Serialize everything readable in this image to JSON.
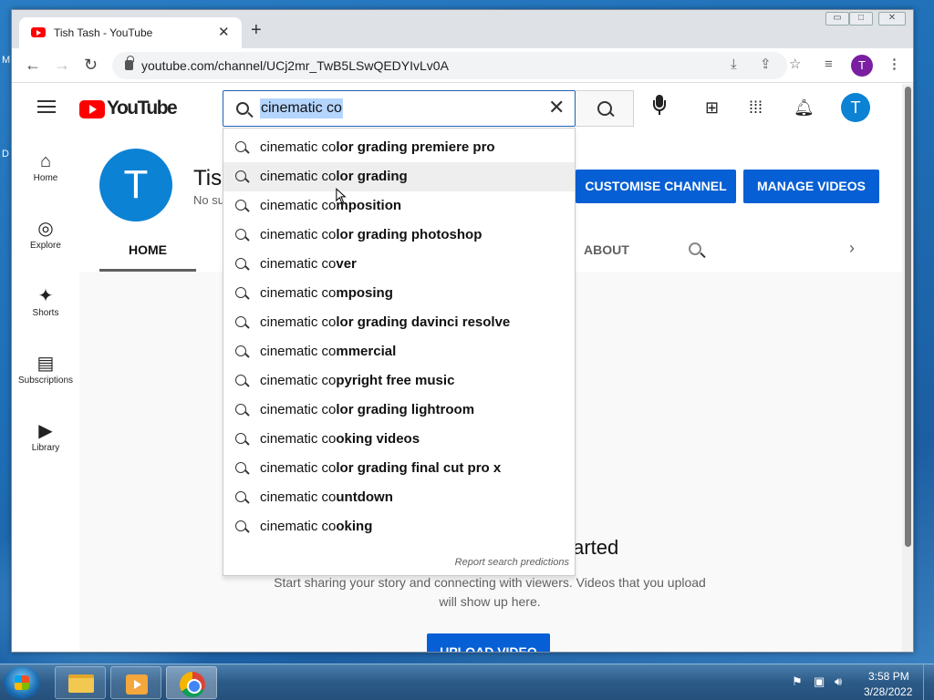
{
  "desktop": {
    "left_letter_1": "M",
    "left_letter_2": "D"
  },
  "browser": {
    "tab_title": "Tish Tash - YouTube",
    "tab_close": "✕",
    "new_tab": "+",
    "address": "youtube.com/channel/UCj2mr_TwB5LSwQEDYIvLv0A",
    "profile_initial": "T",
    "window_controls": [
      "▭",
      "□",
      "✕"
    ]
  },
  "youtube": {
    "logo_text": "YouTube",
    "search": {
      "query": "cinematic co",
      "clear": "✕"
    },
    "avatar_initial": "T",
    "sidebar": [
      {
        "label": "Home",
        "glyph": "⌂"
      },
      {
        "label": "Explore",
        "glyph": "◎"
      },
      {
        "label": "Shorts",
        "glyph": "✦"
      },
      {
        "label": "Subscriptions",
        "glyph": "▤"
      },
      {
        "label": "Library",
        "glyph": "▶"
      }
    ],
    "channel": {
      "avatar_initial": "T",
      "name": "Tis",
      "subs": "No su",
      "customise_button": "CUSTOMISE CHANNEL",
      "manage_button": "MANAGE VIDEOS",
      "tab_home": "HOME",
      "tab_about": "ABOUT",
      "tab_next": "›"
    },
    "empty_state": {
      "title": "tarted",
      "text": "Start sharing your story and connecting with viewers. Videos that you upload will show up here.",
      "upload_button": "UPLOAD VIDEO"
    },
    "suggestions": [
      {
        "prefix": "cinematic co",
        "rest": "lor grading premiere pro"
      },
      {
        "prefix": "cinematic co",
        "rest": "lor grading"
      },
      {
        "prefix": "cinematic co",
        "rest": "mposition"
      },
      {
        "prefix": "cinematic co",
        "rest": "lor grading photoshop"
      },
      {
        "prefix": "cinematic co",
        "rest": "ver"
      },
      {
        "prefix": "cinematic co",
        "rest": "mposing"
      },
      {
        "prefix": "cinematic co",
        "rest": "lor grading davinci resolve"
      },
      {
        "prefix": "cinematic co",
        "rest": "mmercial"
      },
      {
        "prefix": "cinematic co",
        "rest": "pyright free music"
      },
      {
        "prefix": "cinematic co",
        "rest": "lor grading lightroom"
      },
      {
        "prefix": "cinematic co",
        "rest": "oking videos"
      },
      {
        "prefix": "cinematic co",
        "rest": "lor grading final cut pro x"
      },
      {
        "prefix": "cinematic co",
        "rest": "untdown"
      },
      {
        "prefix": "cinematic co",
        "rest": "oking"
      }
    ],
    "report_predictions": "Report search predictions"
  },
  "taskbar": {
    "time": "3:58 PM",
    "date": "3/28/2022"
  }
}
